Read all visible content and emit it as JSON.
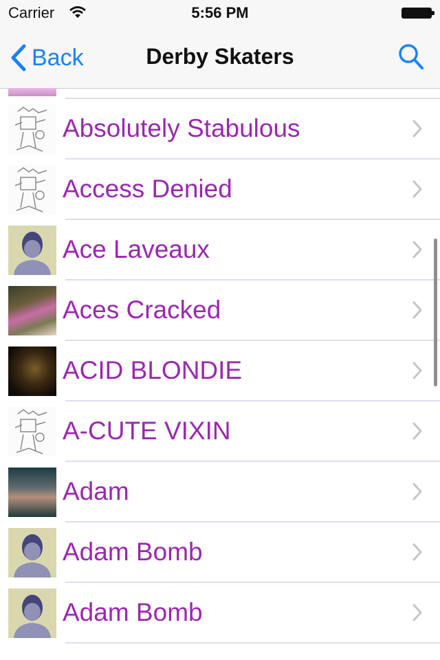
{
  "status_bar": {
    "carrier": "Carrier",
    "time": "5:56 PM"
  },
  "nav": {
    "back_label": "Back",
    "title": "Derby Skaters",
    "accent_color": "#1a82f7"
  },
  "list": {
    "name_color": "#9b27b0",
    "rows": [
      {
        "name": "Absolutely Stabulous",
        "thumb": "sketch-logo"
      },
      {
        "name": "Access Denied",
        "thumb": "sketch-logo"
      },
      {
        "name": "Ace Laveaux",
        "thumb": "person-placeholder"
      },
      {
        "name": "Aces Cracked",
        "thumb": "photo"
      },
      {
        "name": "ACID BLONDIE",
        "thumb": "photo"
      },
      {
        "name": "A-CUTE VIXIN",
        "thumb": "sketch-logo"
      },
      {
        "name": "Adam",
        "thumb": "photo"
      },
      {
        "name": "Adam Bomb",
        "thumb": "person-placeholder"
      },
      {
        "name": "Adam Bomb",
        "thumb": "person-placeholder"
      }
    ]
  },
  "icons": {
    "back": "chevron-left-icon",
    "search": "magnifier-icon",
    "disclosure": "chevron-right-icon",
    "wifi": "wifi-icon",
    "battery": "battery-icon"
  }
}
